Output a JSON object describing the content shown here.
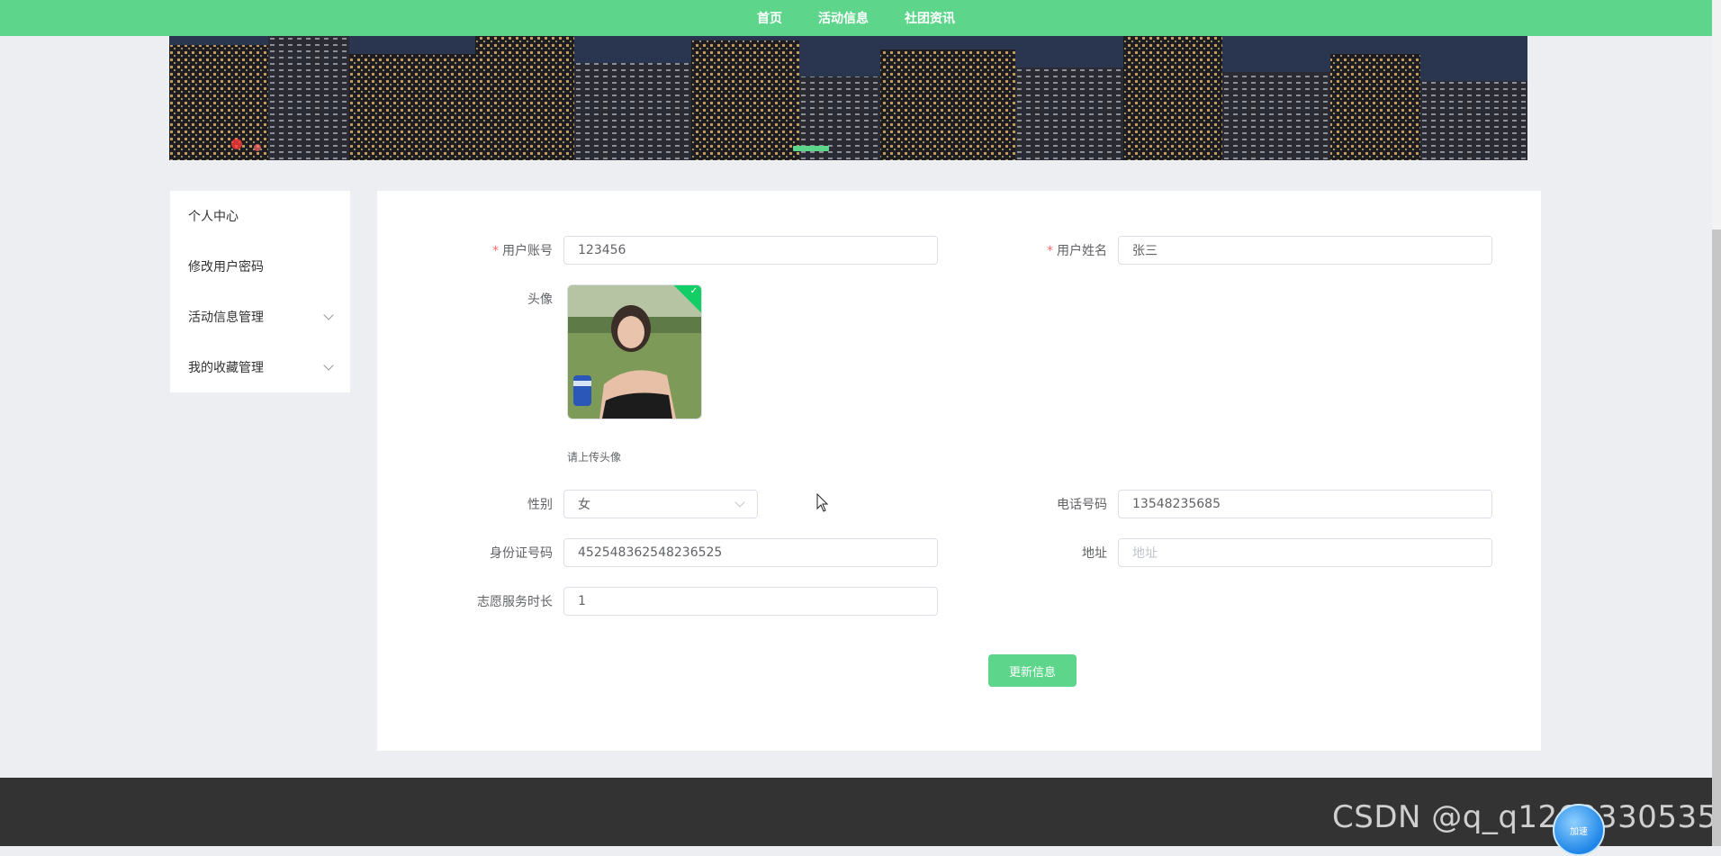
{
  "nav": {
    "items": [
      "首页",
      "活动信息",
      "社团资讯"
    ]
  },
  "sidebar": {
    "items": [
      {
        "label": "个人中心",
        "has_submenu": false
      },
      {
        "label": "修改用户密码",
        "has_submenu": false
      },
      {
        "label": "活动信息管理",
        "has_submenu": true
      },
      {
        "label": "我的收藏管理",
        "has_submenu": true
      }
    ]
  },
  "form": {
    "account": {
      "label": "用户账号",
      "value": "123456",
      "required": true
    },
    "name": {
      "label": "用户姓名",
      "value": "张三",
      "required": true
    },
    "avatar": {
      "label": "头像",
      "hint": "请上传头像"
    },
    "gender": {
      "label": "性别",
      "value": "女"
    },
    "phone": {
      "label": "电话号码",
      "value": "13548235685"
    },
    "id_number": {
      "label": "身份证号码",
      "value": "452548362548236525"
    },
    "address": {
      "label": "地址",
      "placeholder": "地址"
    },
    "volunteer_hours": {
      "label": "志愿服务时长",
      "value": "1"
    },
    "submit_label": "更新信息"
  },
  "required_mark": "*",
  "watermark": "CSDN @q_q1262330535",
  "float_ball_label": "加速",
  "colors": {
    "accent": "#5dd68b",
    "footer": "#333333",
    "required": "#f56c6c"
  }
}
